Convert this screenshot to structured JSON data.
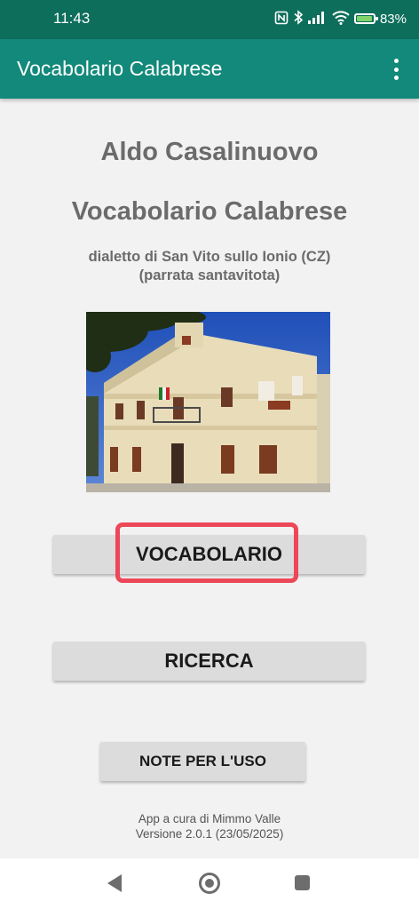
{
  "status_bar": {
    "time": "11:43",
    "battery": "83%",
    "battery_level": 0.83,
    "icons": [
      "nfc-icon",
      "bluetooth-icon",
      "signal-icon",
      "wifi-icon",
      "battery-icon"
    ]
  },
  "app_bar": {
    "title": "Vocabolario Calabrese",
    "menu_icon": "overflow-menu-icon"
  },
  "main": {
    "author": "Aldo Casalinuovo",
    "title": "Vocabolario Calabrese",
    "dialect_line1": "dialetto di San Vito sullo Ionio (CZ)",
    "dialect_line2": "(parrata santavitota)",
    "buttons": {
      "vocabolario": "VOCABOLARIO",
      "ricerca": "RICERCA",
      "note": "NOTE PER L'USO"
    },
    "credits_line1": "App a cura di Mimmo Valle",
    "credits_line2": "Versione 2.0.1 (23/05/2025)"
  },
  "colors": {
    "status_bar": "#0e6e5c",
    "app_bar": "#12897a",
    "background": "#f2f2f2",
    "button": "#dcdcdc",
    "highlight": "#ec4858"
  },
  "nav_bar": {
    "icons": [
      "back-icon",
      "home-icon",
      "recents-icon"
    ]
  }
}
